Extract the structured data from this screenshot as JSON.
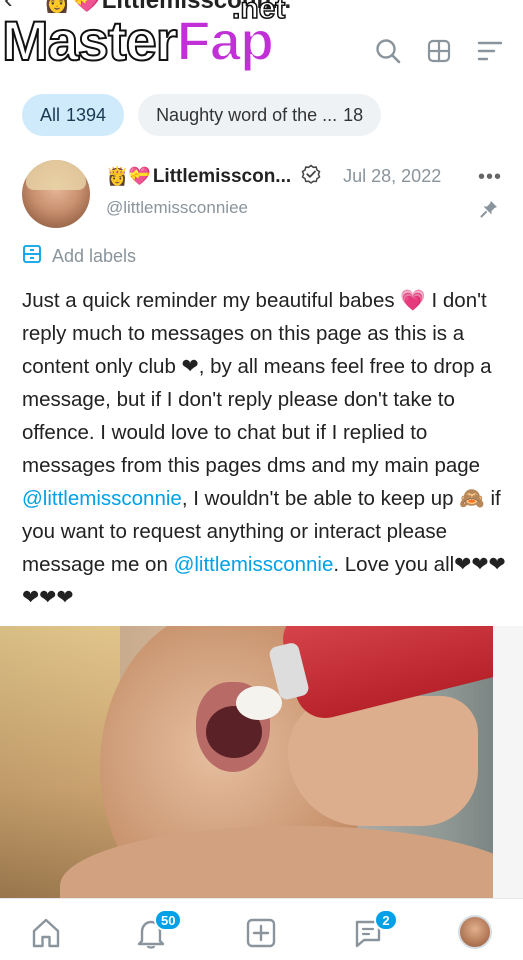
{
  "header": {
    "title": "👸💝Littlemissconn...",
    "watermark_master": "Master",
    "watermark_fap": "Fap",
    "watermark_net": ".net"
  },
  "filters": [
    {
      "label": "All",
      "count": "1394",
      "active": true
    },
    {
      "label": "Naughty word of the ...",
      "count": "18",
      "active": false
    }
  ],
  "post": {
    "crown": "👸💝",
    "display_name": "Littlemisscon...",
    "date": "Jul 28, 2022",
    "username": "@littlemissconniee",
    "add_labels": "Add labels",
    "text_1": "Just a quick reminder my beautiful babes 💗 I don't reply much to messages on this page as this is a content only club ❤, by all means feel free to drop a message, but if I don't reply please don't take to offence. I would love to chat but if I replied to messages from this pages dms and my main page ",
    "mention_1": "@littlemissconnie",
    "text_2": ", I wouldn't be able to keep up 🙈 if you want to request anything or interact please message me on ",
    "mention_2": "@littlemissconnie",
    "text_3": ". Love you all❤❤❤❤❤❤"
  },
  "nav": {
    "notifications_badge": "50",
    "messages_badge": "2"
  },
  "colors": {
    "accent": "#00a1e6",
    "chip_active_bg": "#cfeafb",
    "muted_text": "#8a949c"
  }
}
